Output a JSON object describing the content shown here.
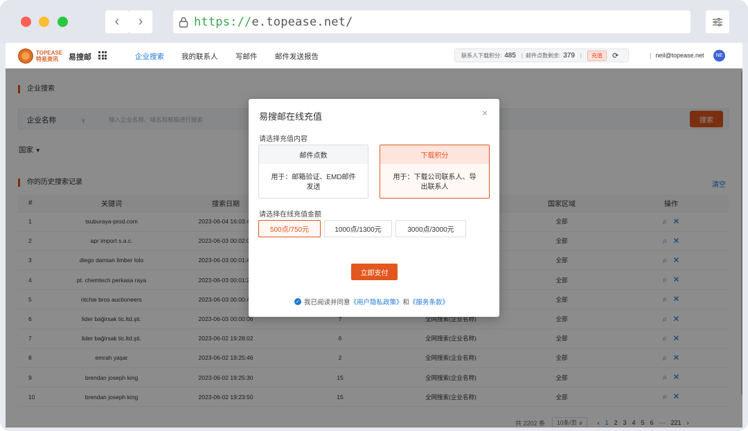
{
  "browser": {
    "url_scheme": "https://",
    "url_host": "e.topease.net/"
  },
  "app": {
    "logo_text_1": "TOPEASE",
    "logo_text_2": "特易资讯",
    "brand": "易搜邮",
    "nav": [
      "企业搜索",
      "我的联系人",
      "写邮件",
      "邮件发送报告"
    ],
    "active_nav": "企业搜索",
    "credits": {
      "download_label": "联系人下载积分:",
      "download_value": "485",
      "email_label": "邮件点数剩余:",
      "email_value": "379",
      "recharge": "充值"
    },
    "user_email": "neil@topease.net",
    "avatar": "NE"
  },
  "search": {
    "section_title": "企业搜索",
    "field_select": "企业名称",
    "placeholder": "输入企业名称、域名和邮箱进行搜索",
    "button": "搜索",
    "country_filter": "国家"
  },
  "history": {
    "section_title": "你的历史搜索记录",
    "clear": "清空",
    "columns": [
      "#",
      "关键词",
      "搜索日期",
      "",
      "",
      "国家区域",
      "操作"
    ],
    "rows": [
      {
        "no": "1",
        "keyword": "tsuburaya-prod.com",
        "date": "2023-06-04 16:03:47",
        "count": "",
        "type": "",
        "region": "全部"
      },
      {
        "no": "2",
        "keyword": "apr import s.a.c.",
        "date": "2023-06-03 00:02:05",
        "count": "",
        "type": "",
        "region": "全部"
      },
      {
        "no": "3",
        "keyword": "diego damian limber lolo",
        "date": "2023-06-03 00:01:44",
        "count": "",
        "type": "",
        "region": "全部"
      },
      {
        "no": "4",
        "keyword": "pt. chemtech perkasa raya",
        "date": "2023-06-03 00:01:23",
        "count": "",
        "type": "",
        "region": "全部"
      },
      {
        "no": "5",
        "keyword": "ritchie bros auctioneers",
        "date": "2023-06-03 00:00:48",
        "count": "",
        "type": "",
        "region": "全部"
      },
      {
        "no": "6",
        "keyword": "lider bağirsak tic.ltd.şti.",
        "date": "2023-06-03 00:00:06",
        "count": "7",
        "type": "全网搜索(企业名称)",
        "region": "全部"
      },
      {
        "no": "7",
        "keyword": "lider bağirsak tic.ltd.şti.",
        "date": "2023-06-02 19:28:02",
        "count": "6",
        "type": "全网搜索(企业名称)",
        "region": "全部"
      },
      {
        "no": "8",
        "keyword": "emrah yaşar",
        "date": "2023-06-02 19:25:46",
        "count": "2",
        "type": "全网搜索(企业名称)",
        "region": "全部"
      },
      {
        "no": "9",
        "keyword": "brendan joseph king",
        "date": "2023-06-02 19:25:30",
        "count": "15",
        "type": "全网搜索(企业名称)",
        "region": "全部"
      },
      {
        "no": "10",
        "keyword": "brendan joseph king",
        "date": "2023-06-02 19:23:50",
        "count": "15",
        "type": "全网搜索(企业名称)",
        "region": "全部"
      }
    ],
    "pager": {
      "total": "共 2202 条",
      "page_size": "10条/页",
      "pages": [
        "1",
        "2",
        "3",
        "4",
        "5",
        "6",
        "···",
        "221"
      ],
      "prev": "‹",
      "next": "›"
    }
  },
  "modal": {
    "title": "易搜邮在线充值",
    "close": "×",
    "content_label": "请选择充值内容",
    "options": [
      {
        "title": "邮件点数",
        "desc": "用于：邮箱验证、EMD邮件发送",
        "selected": false
      },
      {
        "title": "下载积分",
        "desc": "用于：下载公司联系人、导出联系人",
        "selected": true
      }
    ],
    "amount_label": "请选择在线充值金额",
    "amounts": [
      {
        "label": "500点/750元",
        "selected": true
      },
      {
        "label": "1000点/1300元",
        "selected": false
      },
      {
        "label": "3000点/3000元",
        "selected": false
      }
    ],
    "pay_button": "立即支付",
    "agree_prefix": "我已阅读并同意",
    "privacy": "《用户隐私政策》",
    "and": "和",
    "terms": "《服务条款》"
  },
  "colors": {
    "accent": "#e2571e",
    "link": "#1f78d1"
  }
}
